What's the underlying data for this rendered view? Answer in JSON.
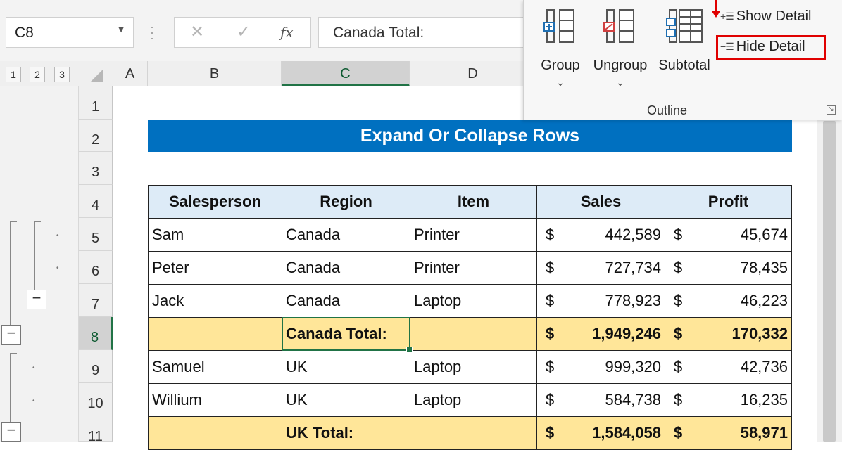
{
  "formula_bar": {
    "name_box": "C8",
    "cancel_icon": "✕",
    "enter_icon": "✓",
    "fx_icon": "fx",
    "formula": "Canada Total:"
  },
  "outline_levels": [
    "1",
    "2",
    "3"
  ],
  "columns": [
    "A",
    "B",
    "C",
    "D"
  ],
  "rows": [
    "1",
    "2",
    "3",
    "4",
    "5",
    "6",
    "7",
    "8",
    "9",
    "10",
    "11"
  ],
  "outline_buttons": {
    "collapse": "−"
  },
  "sheet": {
    "title": "Expand Or Collapse Rows",
    "headers": [
      "Salesperson",
      "Region",
      "Item",
      "Sales",
      "Profit"
    ],
    "currency": "$",
    "records": [
      {
        "salesperson": "Sam",
        "region": "Canada",
        "item": "Printer",
        "sales": "442,589",
        "profit": "45,674",
        "total": false
      },
      {
        "salesperson": "Peter",
        "region": "Canada",
        "item": "Printer",
        "sales": "727,734",
        "profit": "78,435",
        "total": false
      },
      {
        "salesperson": "Jack",
        "region": "Canada",
        "item": "Laptop",
        "sales": "778,923",
        "profit": "46,223",
        "total": false
      },
      {
        "salesperson": "",
        "region": "Canada Total:",
        "item": "",
        "sales": "1,949,246",
        "profit": "170,332",
        "total": true
      },
      {
        "salesperson": "Samuel",
        "region": "UK",
        "item": "Laptop",
        "sales": "999,320",
        "profit": "42,736",
        "total": false
      },
      {
        "salesperson": "Willium",
        "region": "UK",
        "item": "Laptop",
        "sales": "584,738",
        "profit": "16,235",
        "total": false
      },
      {
        "salesperson": "",
        "region": "UK Total:",
        "item": "",
        "sales": "1,584,058",
        "profit": "58,971",
        "total": true
      }
    ]
  },
  "ribbon": {
    "group_label": "Outline",
    "group": "Group",
    "ungroup": "Ungroup",
    "subtotal": "Subtotal",
    "show_detail": "Show Detail",
    "hide_detail": "Hide Detail",
    "caret": "⌄",
    "launcher_icon": "↘"
  },
  "colors": {
    "title_fill": "#0070c0",
    "header_fill": "#ddebf7",
    "total_fill": "#ffe699",
    "selection": "#217346",
    "highlight": "#e00000"
  }
}
